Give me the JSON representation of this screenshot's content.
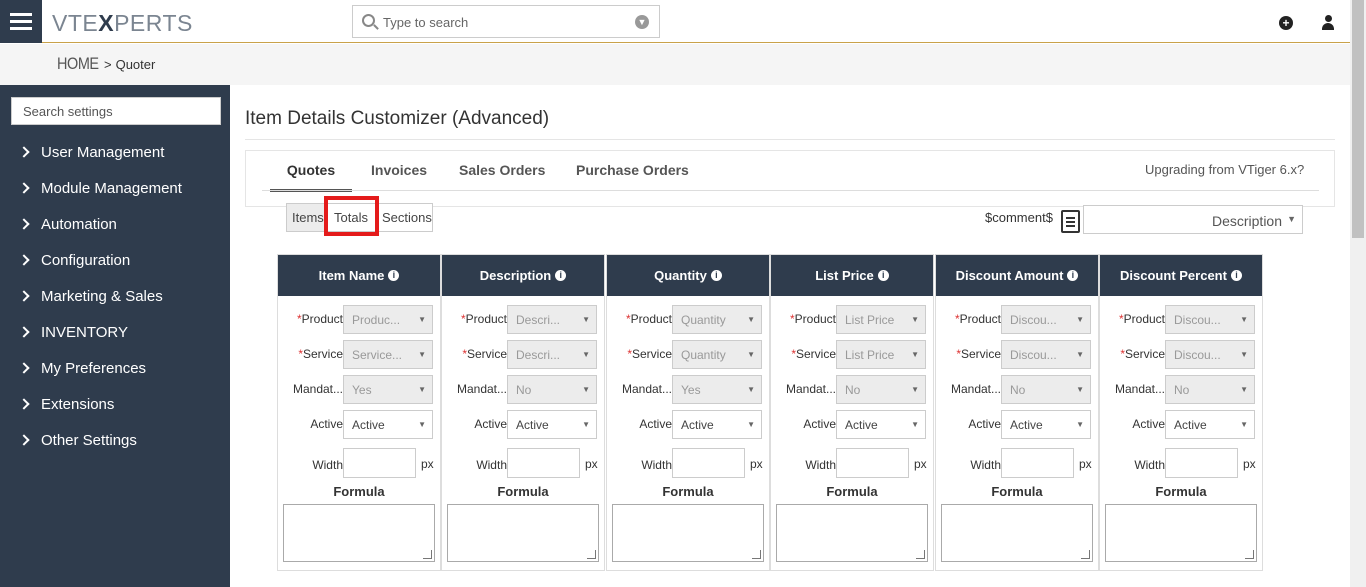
{
  "header": {
    "logo": {
      "part1": "VTE",
      "part2": "X",
      "part3": "PERTS"
    },
    "search_placeholder": "Type to search"
  },
  "breadcrumb": {
    "home": "HOME",
    "separator": ">",
    "current": "Quoter"
  },
  "sidebar": {
    "search_placeholder": "Search settings",
    "items": [
      {
        "label": "User Management"
      },
      {
        "label": "Module Management"
      },
      {
        "label": "Automation"
      },
      {
        "label": "Configuration"
      },
      {
        "label": "Marketing & Sales"
      },
      {
        "label": "INVENTORY"
      },
      {
        "label": "My Preferences"
      },
      {
        "label": "Extensions"
      },
      {
        "label": "Other Settings"
      }
    ]
  },
  "main": {
    "title": "Item Details Customizer (Advanced)",
    "tabs": [
      {
        "label": "Quotes",
        "active": true
      },
      {
        "label": "Invoices",
        "active": false
      },
      {
        "label": "Sales Orders",
        "active": false
      },
      {
        "label": "Purchase Orders",
        "active": false
      }
    ],
    "upgrade_link": "Upgrading from VTiger 6.x?",
    "subtabs": {
      "items": "Items",
      "totals": "Totals",
      "sections": "Sections"
    },
    "comment_var": "$comment$",
    "description_select": "Description",
    "labels": {
      "product": "Product",
      "service": "Service",
      "mandatory": "Mandat...",
      "active": "Active",
      "width": "Width",
      "px": "px",
      "formula": "Formula",
      "required_mark": "*"
    },
    "columns": [
      {
        "title": "Item Name",
        "product": "Produc...",
        "service": "Service...",
        "mandatory": "Yes",
        "active": "Active"
      },
      {
        "title": "Description",
        "product": "Descri...",
        "service": "Descri...",
        "mandatory": "No",
        "active": "Active"
      },
      {
        "title": "Quantity",
        "product": "Quantity",
        "service": "Quantity",
        "mandatory": "Yes",
        "active": "Active"
      },
      {
        "title": "List Price",
        "product": "List Price",
        "service": "List Price",
        "mandatory": "No",
        "active": "Active"
      },
      {
        "title": "Discount Amount",
        "product": "Discou...",
        "service": "Discou...",
        "mandatory": "No",
        "active": "Active"
      },
      {
        "title": "Discount Percent",
        "product": "Discou...",
        "service": "Discou...",
        "mandatory": "No",
        "active": "Active"
      }
    ]
  }
}
